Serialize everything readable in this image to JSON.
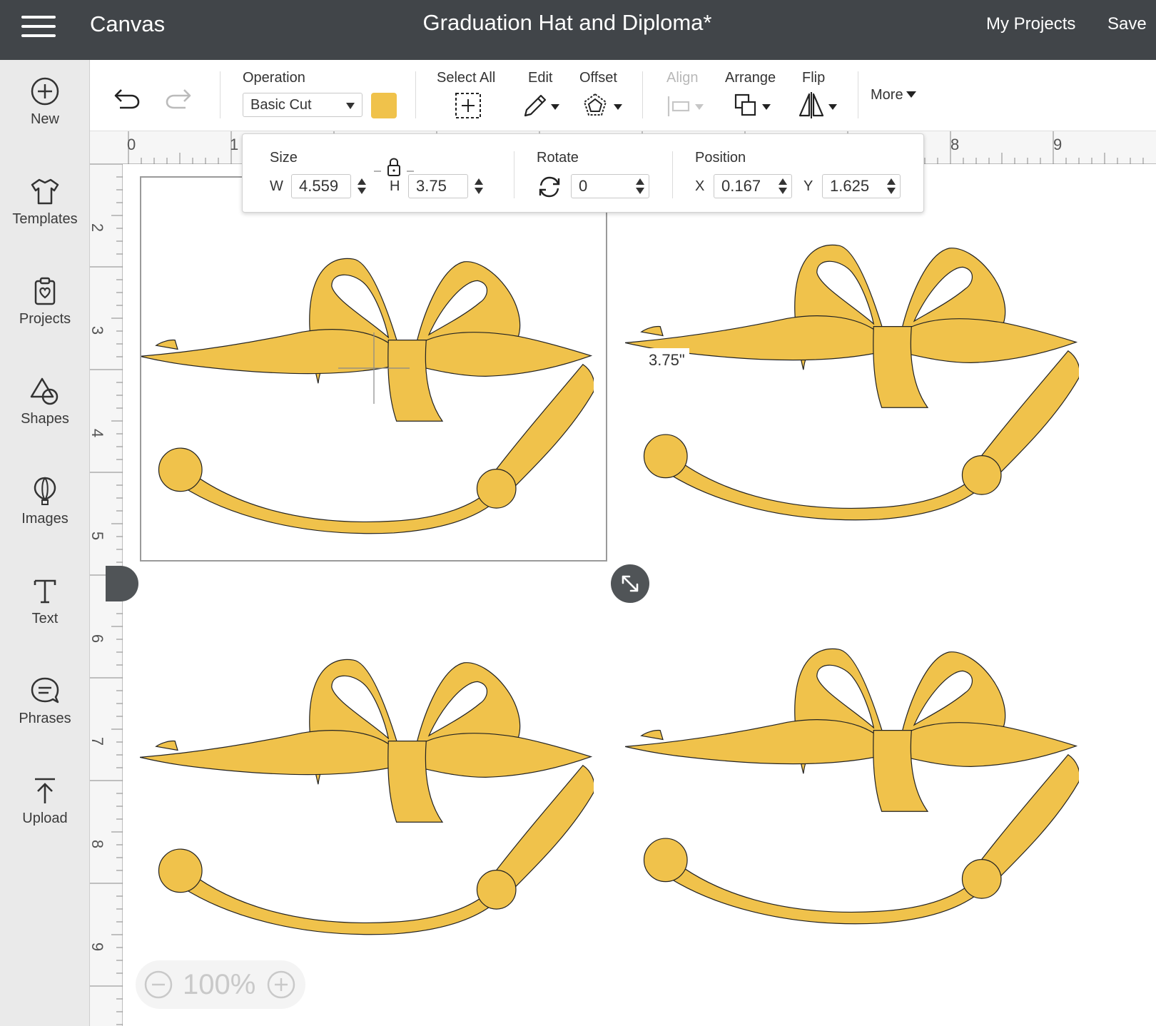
{
  "app": {
    "title": "Canvas",
    "document_title": "Graduation Hat and Diploma*"
  },
  "header": {
    "my_projects": "My Projects",
    "save": "Save"
  },
  "sidebar": {
    "items": [
      {
        "label": "New",
        "icon": "plus-circle-icon"
      },
      {
        "label": "Templates",
        "icon": "tshirt-icon"
      },
      {
        "label": "Projects",
        "icon": "clipboard-heart-icon"
      },
      {
        "label": "Shapes",
        "icon": "shapes-icon"
      },
      {
        "label": "Images",
        "icon": "balloon-icon"
      },
      {
        "label": "Text",
        "icon": "text-icon"
      },
      {
        "label": "Phrases",
        "icon": "speech-bubble-icon"
      },
      {
        "label": "Upload",
        "icon": "upload-icon"
      }
    ]
  },
  "toolbar": {
    "operation_label": "Operation",
    "operation_value": "Basic Cut",
    "material_color": "#f0c24b",
    "select_all": "Select All",
    "edit": "Edit",
    "offset": "Offset",
    "align": "Align",
    "arrange": "Arrange",
    "flip": "Flip",
    "more": "More"
  },
  "size_panel": {
    "size_label": "Size",
    "w_label": "W",
    "w_value": "4.559",
    "h_label": "H",
    "h_value": "3.75",
    "rotate_label": "Rotate",
    "rotate_value": "0",
    "position_label": "Position",
    "x_label": "X",
    "x_value": "0.167",
    "y_label": "Y",
    "y_value": "1.625"
  },
  "ruler": {
    "top": [
      "0",
      "1",
      "8",
      "9"
    ],
    "left": [
      "2",
      "3",
      "4",
      "5",
      "6",
      "7",
      "8",
      "9"
    ]
  },
  "dimension_tag": "3.75\"",
  "zoom": {
    "level": "100%"
  },
  "colors": {
    "topbar": "#414549",
    "shape_fill": "#f0c24b",
    "shape_stroke": "#222222"
  }
}
